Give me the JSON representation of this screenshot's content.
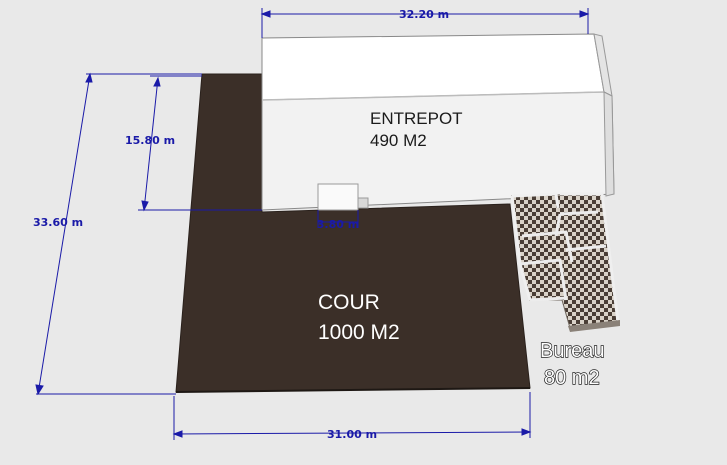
{
  "dimensions": {
    "top_width": "32.20 m",
    "left_outer_depth": "33.60 m",
    "left_inner_depth": "15.80 m",
    "door_width": "3.80 m",
    "bottom_width": "31.00 m"
  },
  "zones": {
    "entrepot": {
      "name": "ENTREPOT",
      "area": "490 M2"
    },
    "cour": {
      "name": "COUR",
      "area": "1000 M2"
    },
    "bureau": {
      "name": "Bureau",
      "area": "80 m2"
    }
  },
  "colors": {
    "background": "#e9e9e9",
    "courtyard": "#3b2f28",
    "warehouse_wall": "#f4f4f4",
    "warehouse_roof": "#ffffff",
    "dimension_line": "#1a1aa8"
  }
}
